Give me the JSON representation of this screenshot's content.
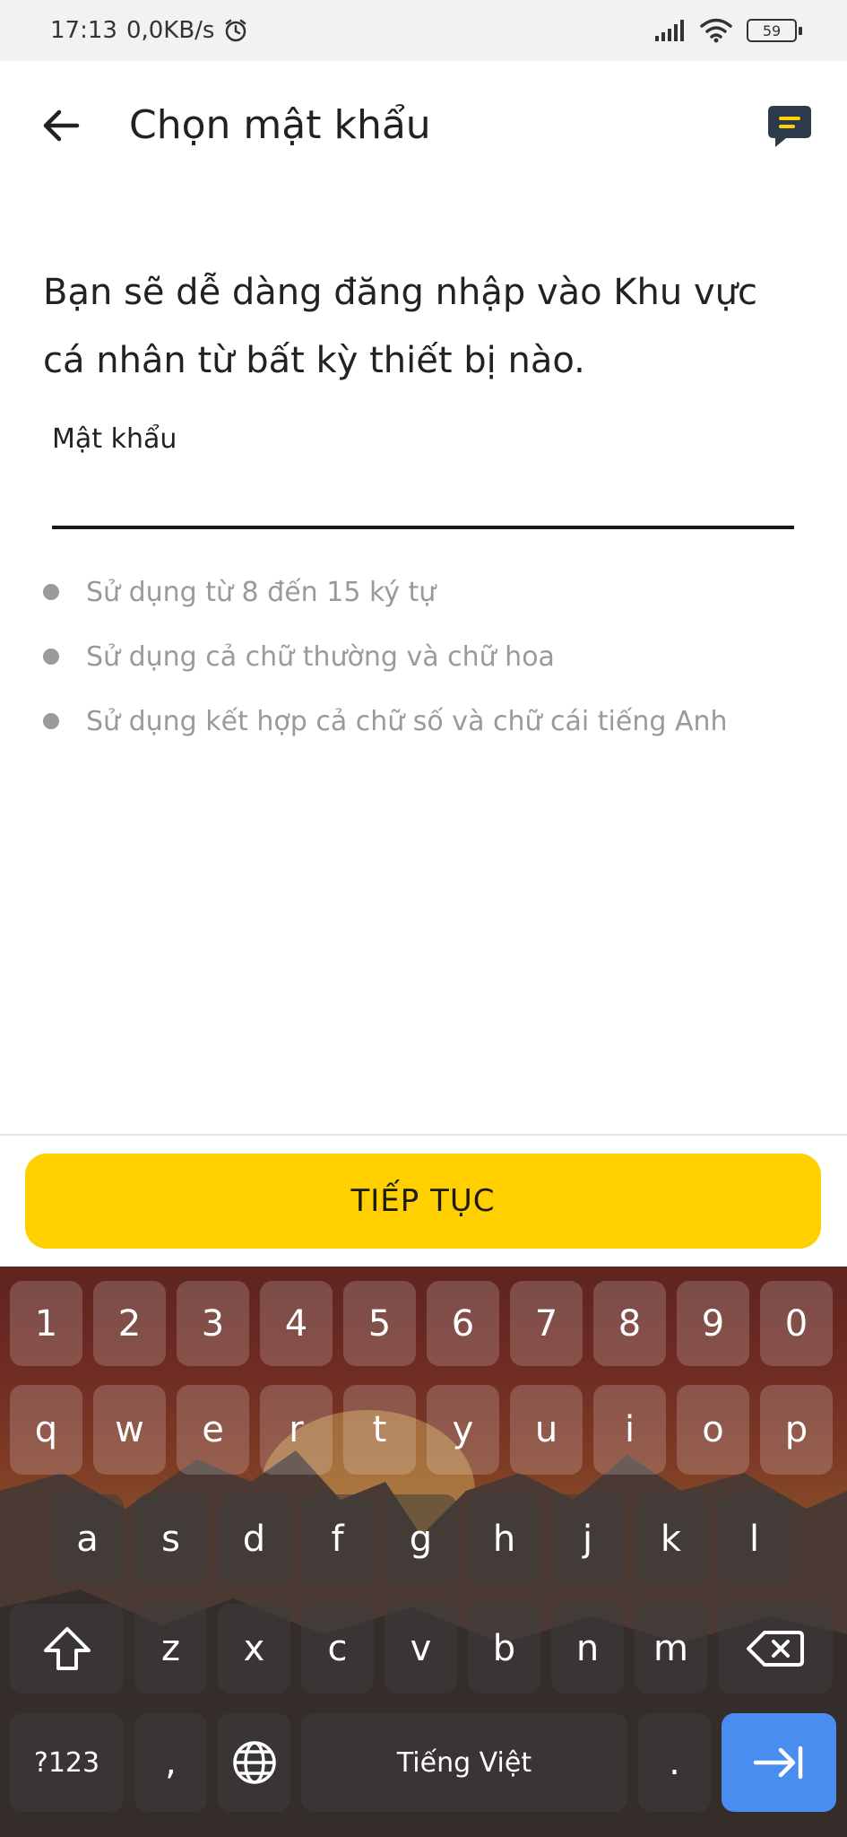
{
  "status_bar": {
    "time": "17:13",
    "network_speed": "0,0KB/s",
    "battery_level": "59",
    "icons": [
      "alarm-icon",
      "signal-icon",
      "wifi-icon",
      "battery-icon"
    ]
  },
  "app_bar": {
    "title": "Chọn mật khẩu",
    "icons": [
      "back-arrow-icon",
      "chat-icon"
    ]
  },
  "intro_text": "Bạn sẽ dễ dàng đăng nhập vào Khu vực cá nhân từ bất kỳ thiết bị nào.",
  "password_field": {
    "label": "Mật khẩu",
    "value": "",
    "placeholder": ""
  },
  "requirements": [
    "Sử dụng từ 8 đến 15 ký tự",
    "Sử dụng cả chữ thường và chữ hoa",
    "Sử dụng kết hợp cả chữ số và chữ cái tiếng Anh"
  ],
  "continue_button": {
    "label": "TIẾP TỤC"
  },
  "keyboard": {
    "number_row": [
      "1",
      "2",
      "3",
      "4",
      "5",
      "6",
      "7",
      "8",
      "9",
      "0"
    ],
    "row1": [
      "q",
      "w",
      "e",
      "r",
      "t",
      "y",
      "u",
      "i",
      "o",
      "p"
    ],
    "row2": [
      "a",
      "s",
      "d",
      "f",
      "g",
      "h",
      "j",
      "k",
      "l"
    ],
    "row3": [
      "z",
      "x",
      "c",
      "v",
      "b",
      "n",
      "m"
    ],
    "symbols_key": "?123",
    "comma_key": ",",
    "space_key": "Tiếng Việt",
    "period_key": ".",
    "icons": [
      "shift-icon",
      "backspace-icon",
      "globe-icon",
      "enter-arrow-icon"
    ],
    "accent_color": "#4a8df0"
  },
  "colors": {
    "primary_button": "#ffcf00",
    "hint_text": "#9a9a9a"
  }
}
